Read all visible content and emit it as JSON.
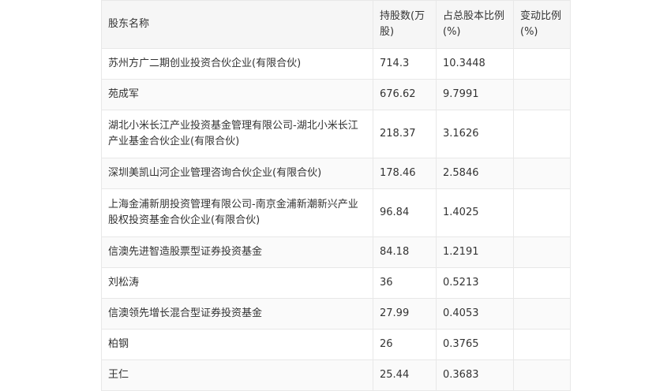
{
  "table": {
    "headers": {
      "name": "股东名称",
      "shares": "持股数(万股)",
      "percent": "占总股本比例(%)",
      "change": "变动比例(%)"
    },
    "rows": [
      {
        "name": "苏州方广二期创业投资合伙企业(有限合伙)",
        "shares": "714.3",
        "percent": "10.3448",
        "change": ""
      },
      {
        "name": "苑成军",
        "shares": "676.62",
        "percent": "9.7991",
        "change": ""
      },
      {
        "name": "湖北小米长江产业投资基金管理有限公司-湖北小米长江产业基金合伙企业(有限合伙)",
        "shares": "218.37",
        "percent": "3.1626",
        "change": ""
      },
      {
        "name": "深圳美凯山河企业管理咨询合伙企业(有限合伙)",
        "shares": "178.46",
        "percent": "2.5846",
        "change": ""
      },
      {
        "name": "上海金浦新朋投资管理有限公司-南京金浦新潮新兴产业股权投资基金合伙企业(有限合伙)",
        "shares": "96.84",
        "percent": "1.4025",
        "change": ""
      },
      {
        "name": "信澳先进智造股票型证券投资基金",
        "shares": "84.18",
        "percent": "1.2191",
        "change": ""
      },
      {
        "name": "刘松涛",
        "shares": "36",
        "percent": "0.5213",
        "change": ""
      },
      {
        "name": "信澳领先增长混合型证券投资基金",
        "shares": "27.99",
        "percent": "0.4053",
        "change": ""
      },
      {
        "name": "柏钢",
        "shares": "26",
        "percent": "0.3765",
        "change": ""
      },
      {
        "name": "王仁",
        "shares": "25.44",
        "percent": "0.3683",
        "change": ""
      }
    ]
  }
}
